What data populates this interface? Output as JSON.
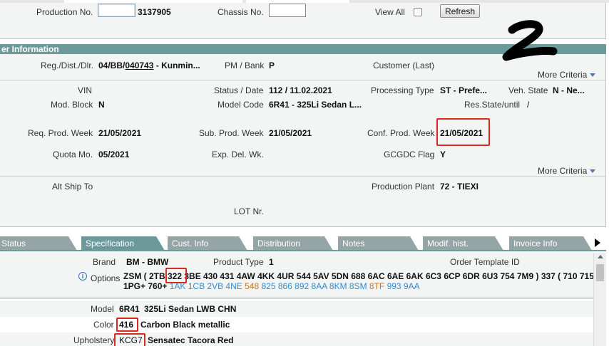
{
  "top_filters": {
    "production_no_label": "Production No.",
    "production_no_value": "3137905",
    "chassis_no_label": "Chassis No.",
    "chassis_no_value": "",
    "view_all_label": "View All",
    "refresh_label": "Refresh"
  },
  "order_info": {
    "section_title": "er Information",
    "reg_label": "Reg./Dist./Dlr.",
    "reg_prefix": "04/BB/",
    "reg_link": "040743",
    "reg_suffix": " - Kunmin...",
    "pm_bank_label": "PM / Bank",
    "pm_bank_value": "P",
    "customer_label": "Customer (Last)",
    "more_criteria_1": "More Criteria",
    "vin_label": "VIN",
    "status_date_label": "Status / Date",
    "status_date_value": "112 /  11.02.2021",
    "processing_type_label": "Processing Type",
    "processing_type_value": "ST - Prefe...",
    "veh_state_label": "Veh. State",
    "veh_state_value": "N - Ne...",
    "mod_block_label": "Mod. Block",
    "mod_block_value": "N",
    "model_code_label": "Model Code",
    "model_code_value": "6R41 - 325Li Sedan L...",
    "res_state_label": "Res.State/until",
    "res_state_value": "/",
    "req_prod_week_label": "Req. Prod. Week",
    "req_prod_week_value": "21/05/2021",
    "sub_prod_week_label": "Sub. Prod. Week",
    "sub_prod_week_value": "21/05/2021",
    "conf_prod_week_label": "Conf. Prod. Week",
    "conf_prod_week_value": "21/05/2021",
    "quota_mo_label": "Quota Mo.",
    "quota_mo_value": "05/2021",
    "exp_del_wk_label": "Exp. Del. Wk.",
    "gcgdc_flag_label": "GCGDC Flag",
    "gcgdc_flag_value": "Y",
    "more_criteria_2": "More Criteria",
    "alt_ship_to_label": "Alt Ship To",
    "production_plant_label": "Production Plant",
    "production_plant_value": "72 - TIEXI",
    "lot_nr_label": "LOT Nr."
  },
  "tabs": [
    {
      "label": "Status"
    },
    {
      "label": "Specification"
    },
    {
      "label": "Cust. Info"
    },
    {
      "label": "Distribution"
    },
    {
      "label": "Notes"
    },
    {
      "label": "Modif. hist."
    },
    {
      "label": "Invoice Info"
    }
  ],
  "specification": {
    "brand_label": "Brand",
    "brand_value": "BM - BMW",
    "product_type_label": "Product Type",
    "product_type_value": "1",
    "order_template_label": "Order Template ID",
    "options_label": "Options",
    "options_line1_a": "ZSM ( 2TB ",
    "options_line1_box": "322",
    "options_line1_b": " 3BE 430 431 4AW 4KK 4UR 544 5AV 5DN 688 6AC 6AE 6AK 6C3 6CP 6DR 6U3 754 7M9 ) 337 ( 710 715",
    "options_line2": [
      {
        "t": "1PG+ 760+ ",
        "c": "black"
      },
      {
        "t": "1AK 1CB 2VB 4NE ",
        "c": "blue"
      },
      {
        "t": "548 ",
        "c": "orange"
      },
      {
        "t": "825 866 892 8AA 8KM 8SM ",
        "c": "blue"
      },
      {
        "t": "8TF ",
        "c": "orange"
      },
      {
        "t": "993 9AA",
        "c": "blue"
      }
    ],
    "model_label": "Model",
    "model_code": "6R41",
    "model_desc": "325Li Sedan LWB CHN",
    "color_label": "Color",
    "color_code": "416",
    "color_desc": "Carbon Black metallic",
    "upholstery_label": "Upholstery",
    "upholstery_code": "KCG7",
    "upholstery_desc": "Sensatec Tacora Red"
  },
  "colors": {
    "section_bar": "#6c9a9b",
    "tab_inactive": "#95a5a6",
    "highlight_red": "#d9281e",
    "option_blue": "#2f8fd6",
    "option_orange": "#d4731a"
  }
}
